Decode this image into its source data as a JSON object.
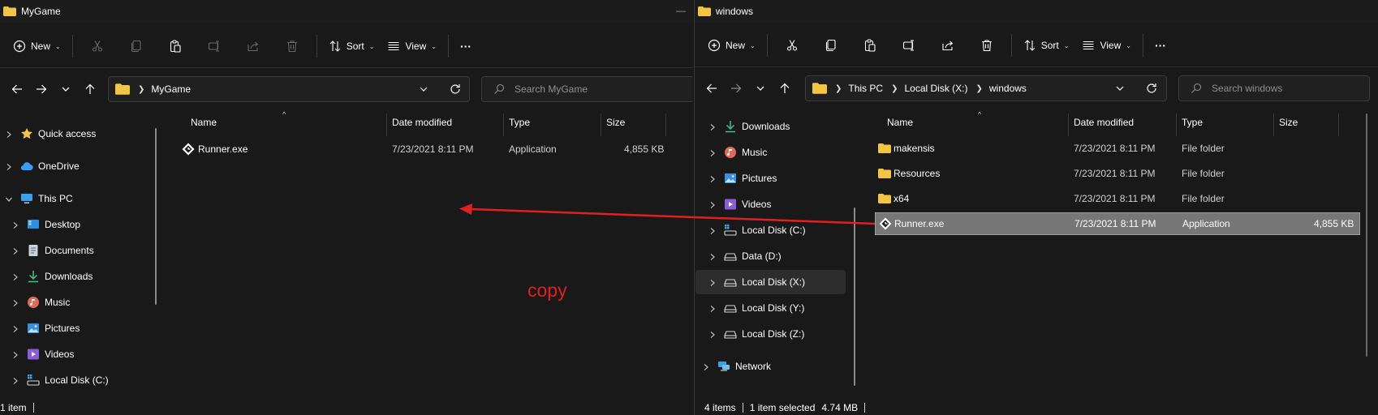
{
  "left": {
    "title": "MyGame",
    "toolbar": {
      "new": "New",
      "sort": "Sort",
      "view": "View",
      "more": "···"
    },
    "address": {
      "crumbs": [
        "MyGame"
      ]
    },
    "search_placeholder": "Search MyGame",
    "nav": [
      {
        "label": "Quick access",
        "icon": "star-icon"
      },
      {
        "label": "OneDrive",
        "icon": "cloud-icon"
      },
      {
        "label": "This PC",
        "icon": "monitor-icon"
      },
      {
        "label": "Desktop",
        "icon": "desktop-icon"
      },
      {
        "label": "Documents",
        "icon": "documents-icon"
      },
      {
        "label": "Downloads",
        "icon": "download-icon"
      },
      {
        "label": "Music",
        "icon": "music-icon"
      },
      {
        "label": "Pictures",
        "icon": "pictures-icon"
      },
      {
        "label": "Videos",
        "icon": "videos-icon"
      },
      {
        "label": "Local Disk (C:)",
        "icon": "windows-drive-icon"
      }
    ],
    "columns": [
      "Name",
      "Date modified",
      "Type",
      "Size"
    ],
    "files": [
      {
        "name": "Runner.exe",
        "date": "7/23/2021 8:11 PM",
        "type": "Application",
        "size": "4,855 KB",
        "icon": "gamemaker-app-icon"
      }
    ],
    "status": {
      "count": "1 item"
    }
  },
  "right": {
    "title": "windows",
    "toolbar": {
      "new": "New",
      "sort": "Sort",
      "view": "View",
      "more": "···"
    },
    "address": {
      "crumbs": [
        "This PC",
        "Local Disk (X:)",
        "windows"
      ]
    },
    "search_placeholder": "Search windows",
    "nav": [
      {
        "label": "Downloads",
        "icon": "download-icon"
      },
      {
        "label": "Music",
        "icon": "music-icon"
      },
      {
        "label": "Pictures",
        "icon": "pictures-icon"
      },
      {
        "label": "Videos",
        "icon": "videos-icon"
      },
      {
        "label": "Local Disk (C:)",
        "icon": "windows-drive-icon"
      },
      {
        "label": "Data (D:)",
        "icon": "drive-icon"
      },
      {
        "label": "Local Disk (X:)",
        "icon": "drive-icon"
      },
      {
        "label": "Local Disk (Y:)",
        "icon": "drive-icon"
      },
      {
        "label": "Local Disk (Z:)",
        "icon": "drive-icon"
      },
      {
        "label": "Network",
        "icon": "network-icon"
      }
    ],
    "selected_nav": "Local Disk (X:)",
    "columns": [
      "Name",
      "Date modified",
      "Type",
      "Size"
    ],
    "files": [
      {
        "name": "makensis",
        "date": "7/23/2021 8:11 PM",
        "type": "File folder",
        "size": "",
        "icon": "folder-icon"
      },
      {
        "name": "Resources",
        "date": "7/23/2021 8:11 PM",
        "type": "File folder",
        "size": "",
        "icon": "folder-icon"
      },
      {
        "name": "x64",
        "date": "7/23/2021 8:11 PM",
        "type": "File folder",
        "size": "",
        "icon": "folder-icon"
      },
      {
        "name": "Runner.exe",
        "date": "7/23/2021 8:11 PM",
        "type": "Application",
        "size": "4,855 KB",
        "icon": "gamemaker-app-icon"
      }
    ],
    "selected_file": "Runner.exe",
    "status": {
      "count": "4 items",
      "selected": "1 item selected",
      "selsize": "4.74 MB"
    }
  },
  "annotation": {
    "text": "copy",
    "color": "#e02020"
  },
  "colors": {
    "background": "#191919",
    "folder": "#f4c542",
    "selection": "#777777",
    "accent": "#4cc2ff"
  }
}
